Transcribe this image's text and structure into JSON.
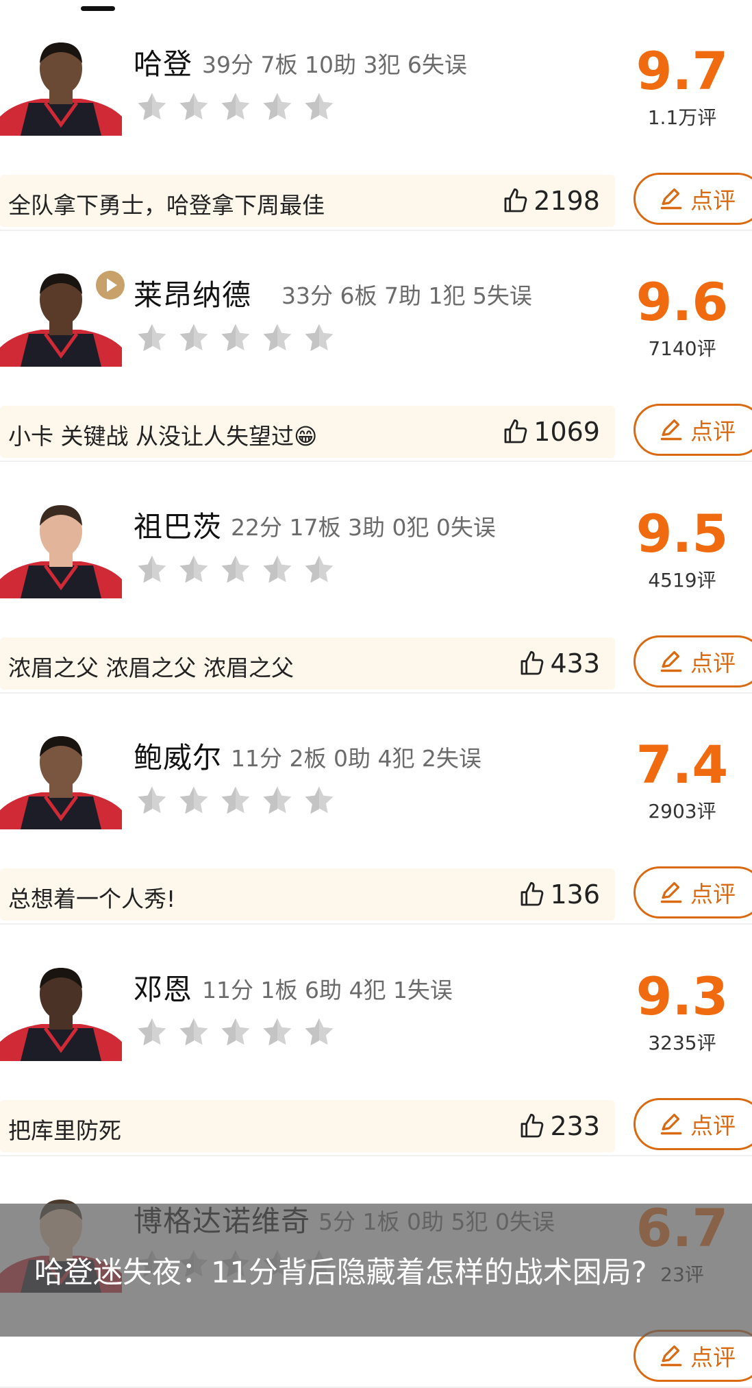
{
  "players": [
    {
      "name": "哈登",
      "stats": "39分 7板 10助 3犯 6失误",
      "score": "9.7",
      "votes": "1.1万评",
      "comment": "全队拿下勇士，哈登拿下周最佳",
      "likes": "2198",
      "review_label": "点评"
    },
    {
      "name": "莱昂纳德",
      "stats": "33分 6板 7助 1犯 5失误",
      "score": "9.6",
      "votes": "7140评",
      "comment": "小卡  关键战  从没让人失望过😁",
      "likes": "1069",
      "review_label": "点评"
    },
    {
      "name": "祖巴茨",
      "stats": "22分 17板 3助 0犯 0失误",
      "score": "9.5",
      "votes": "4519评",
      "comment": "浓眉之父 浓眉之父 浓眉之父",
      "likes": "433",
      "review_label": "点评"
    },
    {
      "name": "鲍威尔",
      "stats": "11分 2板 0助 4犯 2失误",
      "score": "7.4",
      "votes": "2903评",
      "comment": "总想着一个人秀!",
      "likes": "136",
      "review_label": "点评"
    },
    {
      "name": "邓恩",
      "stats": "11分 1板 6助 4犯 1失误",
      "score": "9.3",
      "votes": "3235评",
      "comment": "把库里防死",
      "likes": "233",
      "review_label": "点评"
    },
    {
      "name": "博格达诺维奇",
      "stats": "5分 1板 0助 5犯 0失误",
      "score": "6.7",
      "votes": "23评",
      "comment": "",
      "likes": "",
      "review_label": "点评"
    }
  ],
  "overlay": {
    "title": "哈登迷失夜：11分背后隐藏着怎样的战术困局?"
  },
  "colors": {
    "accent": "#f06b0f",
    "button_border": "#d96a12",
    "comment_bg": "#fdf7ec",
    "star": "#d2d2d2"
  },
  "icons": {
    "like": "thumbs-up-icon",
    "review": "pencil-icon",
    "rating": "star-icon",
    "video": "play-icon"
  }
}
